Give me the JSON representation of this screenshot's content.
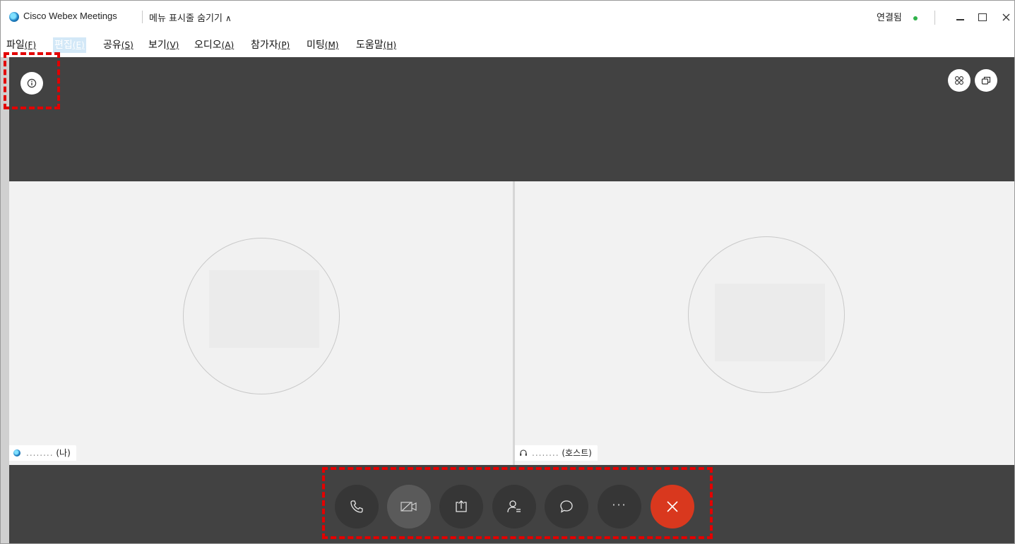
{
  "window": {
    "app_title": "Cisco Webex Meetings",
    "menu_toggle_label": "메뉴 표시줄 숨기기",
    "status_label": "연결됨",
    "status_color": "#2fb24a",
    "controls": {
      "minimize_icon": "minimize-icon",
      "maximize_icon": "maximize-icon",
      "close_icon": "close-icon"
    }
  },
  "menubar": {
    "items": [
      {
        "label": "파일",
        "accel": "(F)"
      },
      {
        "label": "편집",
        "accel": "(E)"
      },
      {
        "label": "공유",
        "accel": "(S)"
      },
      {
        "label": "보기",
        "accel": "(V)"
      },
      {
        "label": "오디오",
        "accel": "(A)"
      },
      {
        "label": "참가자",
        "accel": "(P)"
      },
      {
        "label": "미팅",
        "accel": "(M)"
      },
      {
        "label": "도움말",
        "accel": "(H)"
      }
    ],
    "active_item": "편집"
  },
  "stage": {
    "top_left_icon": "info-icon",
    "top_right_icons": [
      "grid-layout-icon",
      "popout-window-icon"
    ]
  },
  "participants": [
    {
      "name_masked": "........",
      "role": "(나)",
      "icon": "webex-logo-icon"
    },
    {
      "name_masked": "........",
      "role": "(호스트)",
      "icon": "headset-icon"
    }
  ],
  "controls": [
    {
      "name": "audio-button",
      "icon": "phone-icon"
    },
    {
      "name": "video-button",
      "icon": "video-off-icon"
    },
    {
      "name": "share-button",
      "icon": "share-icon"
    },
    {
      "name": "participants-button",
      "icon": "participants-icon"
    },
    {
      "name": "chat-button",
      "icon": "chat-icon"
    },
    {
      "name": "more-button",
      "icon": "more-icon",
      "label": "···"
    },
    {
      "name": "leave-button",
      "icon": "close-icon"
    }
  ],
  "colors": {
    "stage_bg": "#424242",
    "tile_bg": "#f2f2f2",
    "leave_red": "#d9381e",
    "annotation_red": "#e30000",
    "menu_highlight": "#d3e8f7"
  }
}
